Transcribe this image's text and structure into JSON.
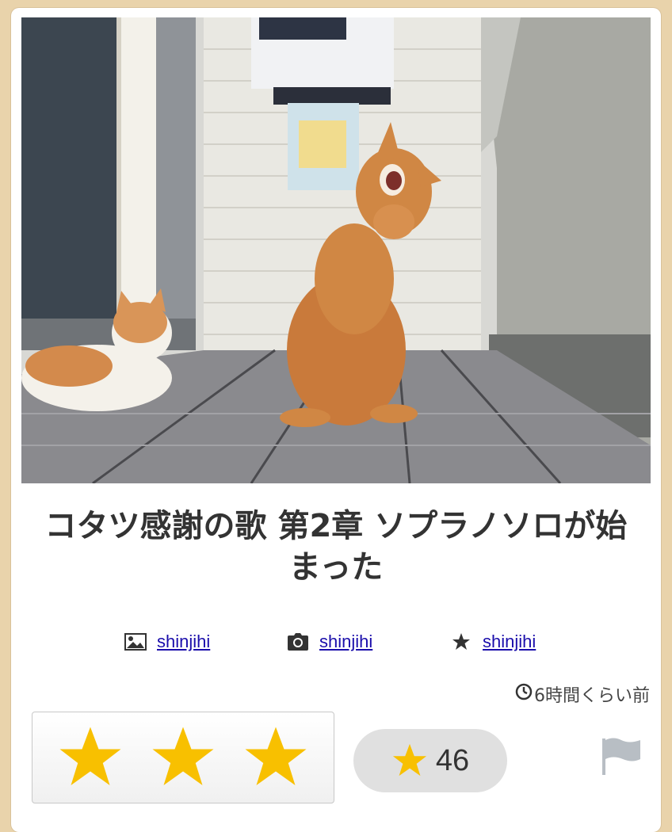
{
  "entry": {
    "title": "コタツ感謝の歌 第2章 ソプラノソロが始まった",
    "photo_alt": "cats on a balcony"
  },
  "credits": [
    {
      "icon": "image-icon",
      "user": "shinjihi"
    },
    {
      "icon": "camera-icon",
      "user": "shinjihi"
    },
    {
      "icon": "star-icon",
      "user": "shinjihi"
    }
  ],
  "meta": {
    "time_ago": "6時間くらい前"
  },
  "rating": {
    "star_count": 46,
    "star_color": "#f8c000"
  },
  "actions": {
    "flag_icon": "flag-icon"
  }
}
